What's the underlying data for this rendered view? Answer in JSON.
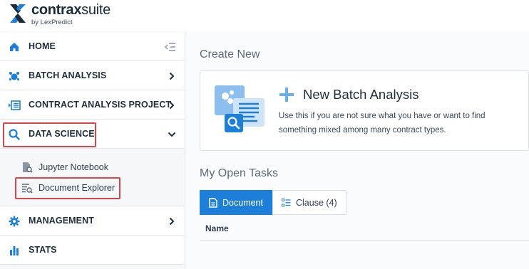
{
  "brand": {
    "name_bold": "contrax",
    "name_light": "suite",
    "tagline": "by LexPredict"
  },
  "sidebar": {
    "items": [
      {
        "label": "HOME",
        "icon": "home-icon"
      },
      {
        "label": "BATCH ANALYSIS",
        "icon": "batch-analysis-icon"
      },
      {
        "label": "CONTRACT ANALYSIS PROJECT",
        "icon": "contract-analysis-icon"
      },
      {
        "label": "DATA SCIENCE",
        "icon": "search-icon"
      },
      {
        "label": "MANAGEMENT",
        "icon": "gear-icon"
      },
      {
        "label": "STATS",
        "icon": "bar-chart-icon"
      }
    ],
    "subitems": [
      {
        "label": "Jupyter Notebook",
        "icon": "document-search-icon"
      },
      {
        "label": "Document Explorer",
        "icon": "list-search-icon"
      }
    ]
  },
  "main": {
    "create_new_title": "Create New",
    "card": {
      "title": "New Batch Analysis",
      "description": "Use this if you are not sure what you have or want to find something mixed among many contract types."
    },
    "open_tasks_title": "My Open Tasks",
    "tabs": [
      {
        "label": "Document",
        "active": true
      },
      {
        "label": "Clause (4)",
        "active": false
      }
    ],
    "table": {
      "columns": [
        "Name"
      ]
    }
  },
  "colors": {
    "accent": "#1e7fd8",
    "highlight": "#d9464c",
    "logo_blue": "#1e7fd8"
  }
}
